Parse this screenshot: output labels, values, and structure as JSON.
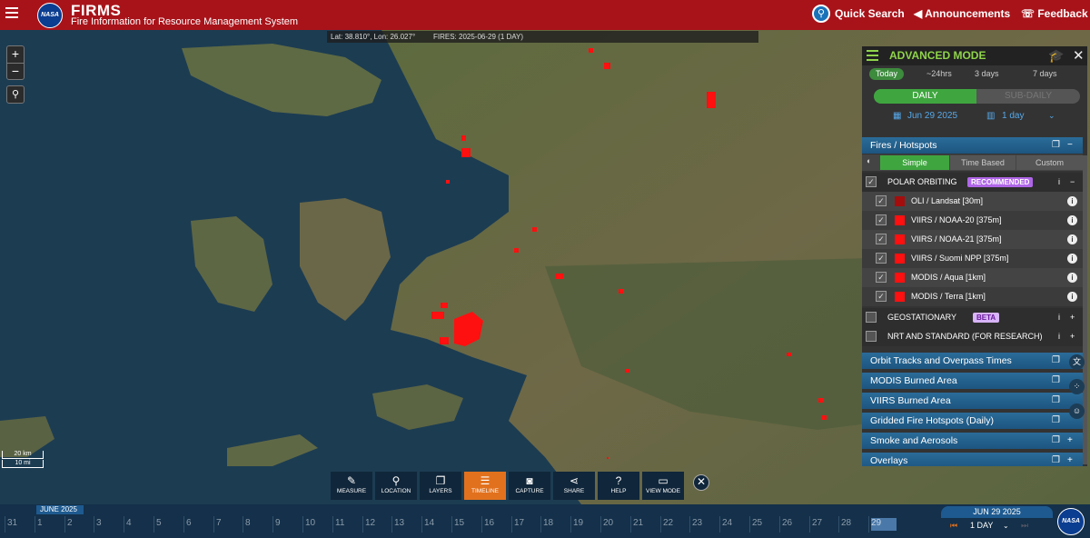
{
  "header": {
    "logo_text": "NASA",
    "title": "FIRMS",
    "subtitle": "Fire Information for Resource Management System",
    "quick_search": "Quick Search",
    "announcements": "Announcements",
    "feedback": "Feedback"
  },
  "map": {
    "coord_readout": "Lat: 38.810°, Lon: 26.027°",
    "fires_readout": "FIRES: 2025-06-29 (1 DAY)",
    "zoom_in": "+",
    "zoom_out": "−",
    "scale_km": "20 km",
    "scale_mi": "10 mi"
  },
  "toolbar": {
    "items": [
      {
        "label": "MEASURE",
        "icon": "ruler-icon",
        "glyph": "✎"
      },
      {
        "label": "LOCATION",
        "icon": "map-pin-icon",
        "glyph": "⚲"
      },
      {
        "label": "LAYERS",
        "icon": "layers-icon",
        "glyph": "❐"
      },
      {
        "label": "TIMELINE",
        "icon": "sliders-icon",
        "glyph": "☰"
      },
      {
        "label": "CAPTURE",
        "icon": "camera-icon",
        "glyph": "◙"
      },
      {
        "label": "SHARE",
        "icon": "share-icon",
        "glyph": "⋖"
      },
      {
        "label": "HELP",
        "icon": "question-icon",
        "glyph": "?"
      },
      {
        "label": "VIEW MODE",
        "icon": "monitor-icon",
        "glyph": "▭"
      }
    ],
    "active": "TIMELINE",
    "close": "✕"
  },
  "panel": {
    "title": "ADVANCED MODE",
    "ranges": [
      "Today",
      "~24hrs",
      "3 days",
      "7 days"
    ],
    "selected_range": "Today",
    "daily": "DAILY",
    "subdaily": "SUB-DAILY",
    "date": "Jun 29 2025",
    "duration": "1 day",
    "fires_section": "Fires / Hotspots",
    "modes": [
      "Simple",
      "Time Based",
      "Custom"
    ],
    "selected_mode": "Simple",
    "polar": "POLAR ORBITING",
    "recommended": "RECOMMENDED",
    "layers": [
      {
        "label": "OLI / Landsat [30m]",
        "color": "#a50d0d",
        "checked": true
      },
      {
        "label": "VIIRS / NOAA-20 [375m]",
        "color": "#ff1010",
        "checked": true
      },
      {
        "label": "VIIRS / NOAA-21 [375m]",
        "color": "#ff1010",
        "checked": true
      },
      {
        "label": "VIIRS / Suomi NPP [375m]",
        "color": "#ff1010",
        "checked": true
      },
      {
        "label": "MODIS / Aqua [1km]",
        "color": "#ff1010",
        "checked": true
      },
      {
        "label": "MODIS / Terra [1km]",
        "color": "#ff1010",
        "checked": true
      }
    ],
    "geostationary": "GEOSTATIONARY",
    "beta": "BETA",
    "nrt": "NRT AND STANDARD (FOR RESEARCH)",
    "sections": [
      "Orbit Tracks and Overpass Times",
      "MODIS Burned Area",
      "VIIRS Burned Area",
      "Gridded Fire Hotspots (Daily)",
      "Smoke and Aerosols",
      "Overlays"
    ]
  },
  "timeline": {
    "month": "JUNE 2025",
    "days": [
      "31",
      "1",
      "2",
      "3",
      "4",
      "5",
      "6",
      "7",
      "8",
      "9",
      "10",
      "11",
      "12",
      "13",
      "14",
      "15",
      "16",
      "17",
      "18",
      "19",
      "20",
      "21",
      "22",
      "23",
      "24",
      "25",
      "26",
      "27",
      "28",
      "29"
    ],
    "selected_day": "29",
    "date_label": "JUN 29 2025",
    "span": "1 DAY"
  },
  "colors": {
    "header": "#a8131a",
    "accent_green": "#3fa63f",
    "fire_red": "#ff1010",
    "section_blue": "#2a6c99",
    "active_tool": "#e2711d"
  }
}
